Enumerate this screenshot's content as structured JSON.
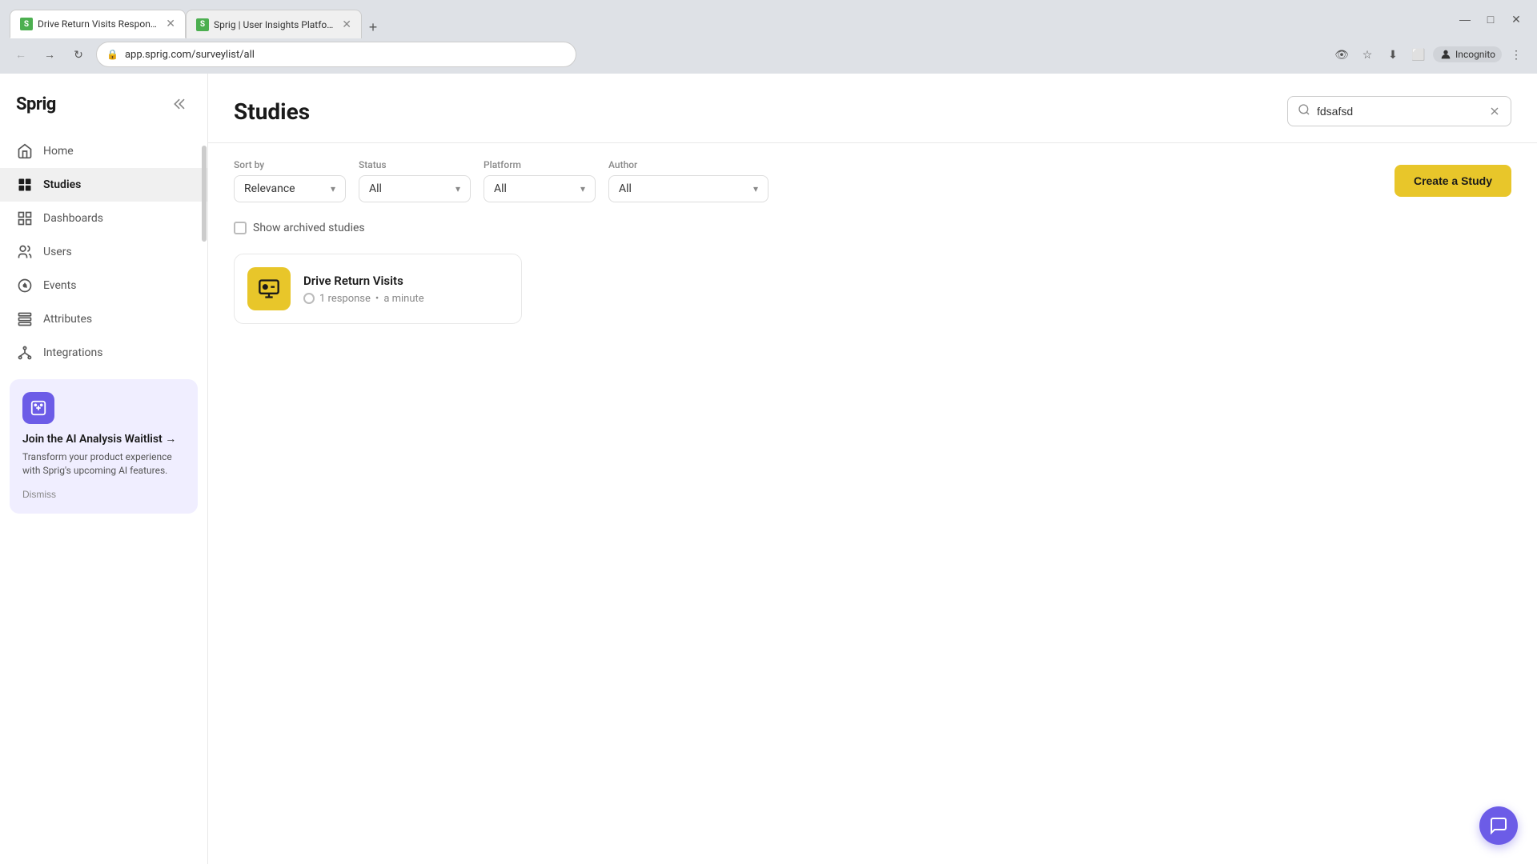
{
  "browser": {
    "tabs": [
      {
        "id": "tab1",
        "favicon_bg": "#4CAF50",
        "favicon_text": "S",
        "title": "Drive Return Visits Responses",
        "active": true
      },
      {
        "id": "tab2",
        "favicon_bg": "#4CAF50",
        "favicon_text": "S",
        "title": "Sprig | User Insights Platform fo...",
        "active": false
      }
    ],
    "url": "app.sprig.com/surveylist/all",
    "incognito_label": "Incognito"
  },
  "sidebar": {
    "logo": "Sprig",
    "collapse_title": "Collapse sidebar",
    "nav_items": [
      {
        "id": "home",
        "label": "Home",
        "active": false
      },
      {
        "id": "studies",
        "label": "Studies",
        "active": true
      },
      {
        "id": "dashboards",
        "label": "Dashboards",
        "active": false
      },
      {
        "id": "users",
        "label": "Users",
        "active": false
      },
      {
        "id": "events",
        "label": "Events",
        "active": false
      },
      {
        "id": "attributes",
        "label": "Attributes",
        "active": false
      },
      {
        "id": "integrations",
        "label": "Integrations",
        "active": false
      }
    ],
    "ai_banner": {
      "title": "Join the AI Analysis Waitlist →",
      "description": "Transform your product experience with Sprig's upcoming AI features.",
      "dismiss_label": "Dismiss"
    }
  },
  "main": {
    "page_title": "Studies",
    "search": {
      "placeholder": "fdsafsd",
      "value": "fdsafsd"
    },
    "filters": {
      "sort_by": {
        "label": "Sort by",
        "value": "Relevance"
      },
      "status": {
        "label": "Status",
        "value": "All"
      },
      "platform": {
        "label": "Platform",
        "value": "All"
      },
      "author": {
        "label": "Author",
        "value": "All"
      }
    },
    "create_study_btn": "Create a Study",
    "show_archived_label": "Show archived studies",
    "studies": [
      {
        "id": "drive-return-visits",
        "name": "Drive Return Visits",
        "responses": "1 response",
        "time": "a minute"
      }
    ]
  }
}
